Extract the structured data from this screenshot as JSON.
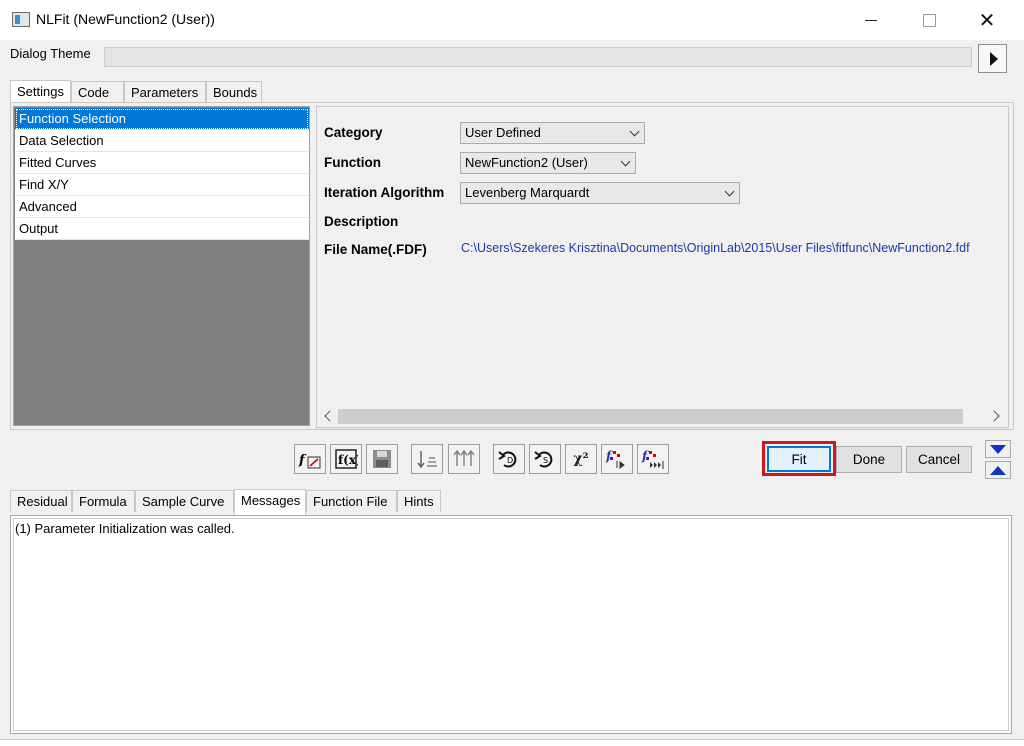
{
  "window": {
    "title": "NLFit (NewFunction2 (User))",
    "minimize_glyph": "",
    "maximize_glyph": "",
    "close_glyph": "✕"
  },
  "dialog_theme": {
    "label": "Dialog Theme",
    "value": ""
  },
  "top_tabs": [
    {
      "label": "Settings",
      "active": true
    },
    {
      "label": "Code",
      "active": false
    },
    {
      "label": "Parameters",
      "active": false
    },
    {
      "label": "Bounds",
      "active": false
    }
  ],
  "nav": {
    "items": [
      {
        "label": "Function Selection",
        "selected": true
      },
      {
        "label": "Data Selection",
        "selected": false
      },
      {
        "label": "Fitted Curves",
        "selected": false
      },
      {
        "label": "Find X/Y",
        "selected": false
      },
      {
        "label": "Advanced",
        "selected": false
      },
      {
        "label": "Output",
        "selected": false
      }
    ]
  },
  "form": {
    "category_label": "Category",
    "category_value": "User Defined",
    "function_label": "Function",
    "function_value": "NewFunction2 (User)",
    "algorithm_label": "Iteration Algorithm",
    "algorithm_value": "Levenberg Marquardt",
    "description_label": "Description",
    "filename_label": "File Name(.FDF)",
    "filename_value": "C:\\Users\\Szekeres Krisztina\\Documents\\OriginLab\\2015\\User Files\\fitfunc\\NewFunction2.fdf"
  },
  "toolbar": {
    "icons": [
      "initialize-parameters-icon",
      "function-builder-icon",
      "save-fdf-icon",
      "sort-ascending-icon",
      "sort-descending-icon",
      "undo-icon",
      "undo-step-icon",
      "chi-square-icon",
      "one-iteration-icon",
      "fit-until-converged-icon"
    ],
    "chi_glyph": "χ²",
    "fit_label": "Fit",
    "done_label": "Done",
    "cancel_label": "Cancel"
  },
  "bottom_tabs": [
    {
      "label": "Residual",
      "active": false
    },
    {
      "label": "Formula",
      "active": false
    },
    {
      "label": "Sample Curve",
      "active": false
    },
    {
      "label": "Messages",
      "active": true
    },
    {
      "label": "Function File",
      "active": false
    },
    {
      "label": "Hints",
      "active": false
    }
  ],
  "messages": {
    "text": "(1) Parameter Initialization was called."
  },
  "colors": {
    "selection": "#0078d7",
    "highlight_border": "#d6141e",
    "link_text": "#1a3aa8",
    "arrow_blue": "#1434c8"
  }
}
